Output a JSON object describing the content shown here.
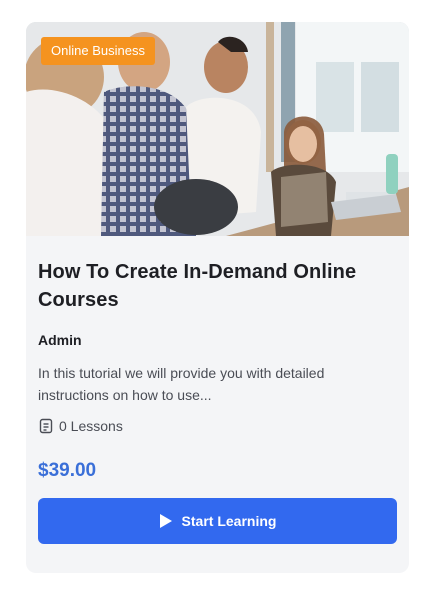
{
  "course": {
    "category": "Online Business",
    "title": "How To Create In-Demand Online Courses",
    "author": "Admin",
    "excerpt": "In this tutorial we will provide you with detailed instructions on how to use...",
    "lessons_icon": "lesson-list-icon",
    "lessons_text": "0 Lessons",
    "price": "$39.00",
    "button_icon": "play-icon",
    "button_label": "Start Learning"
  },
  "colors": {
    "card_background": "#f4f5f7",
    "category_badge": "#f5931f",
    "price": "#3a6fd8",
    "button": "#3269ef"
  }
}
